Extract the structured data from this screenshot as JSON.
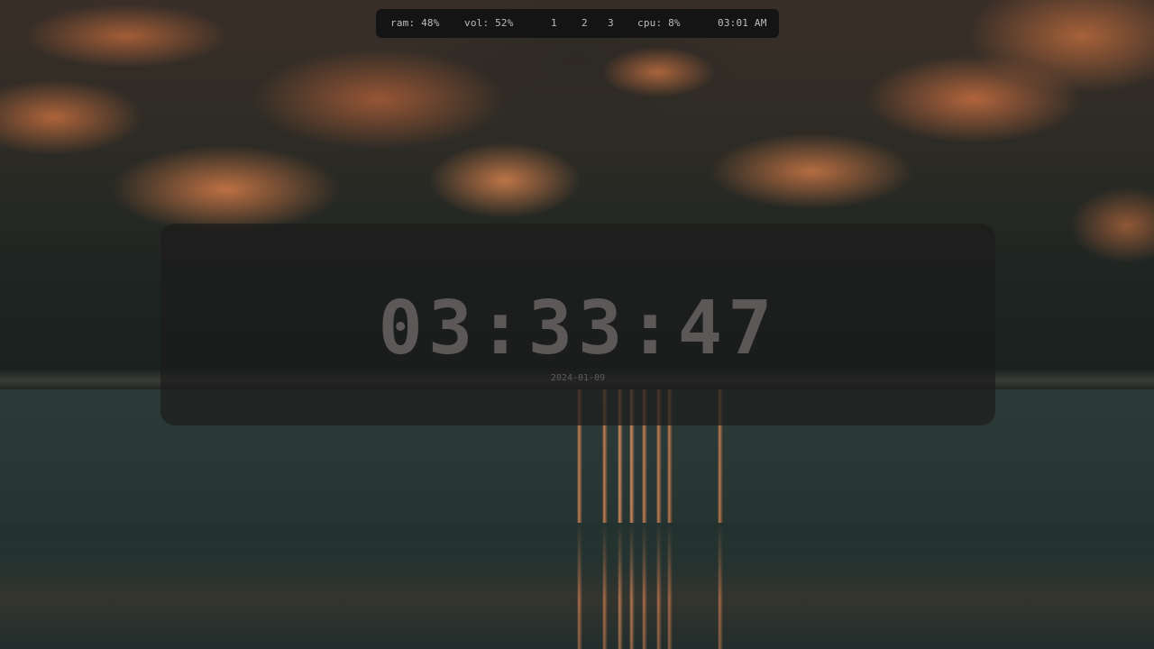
{
  "statusbar": {
    "ram": "ram: 48%",
    "vol": "vol: 52%",
    "workspaces": [
      "1",
      "2",
      "3"
    ],
    "cpu": "cpu: 8%",
    "time": "03:01 AM"
  },
  "clock": {
    "time": "03:33:47",
    "date": "2024-01-09"
  }
}
